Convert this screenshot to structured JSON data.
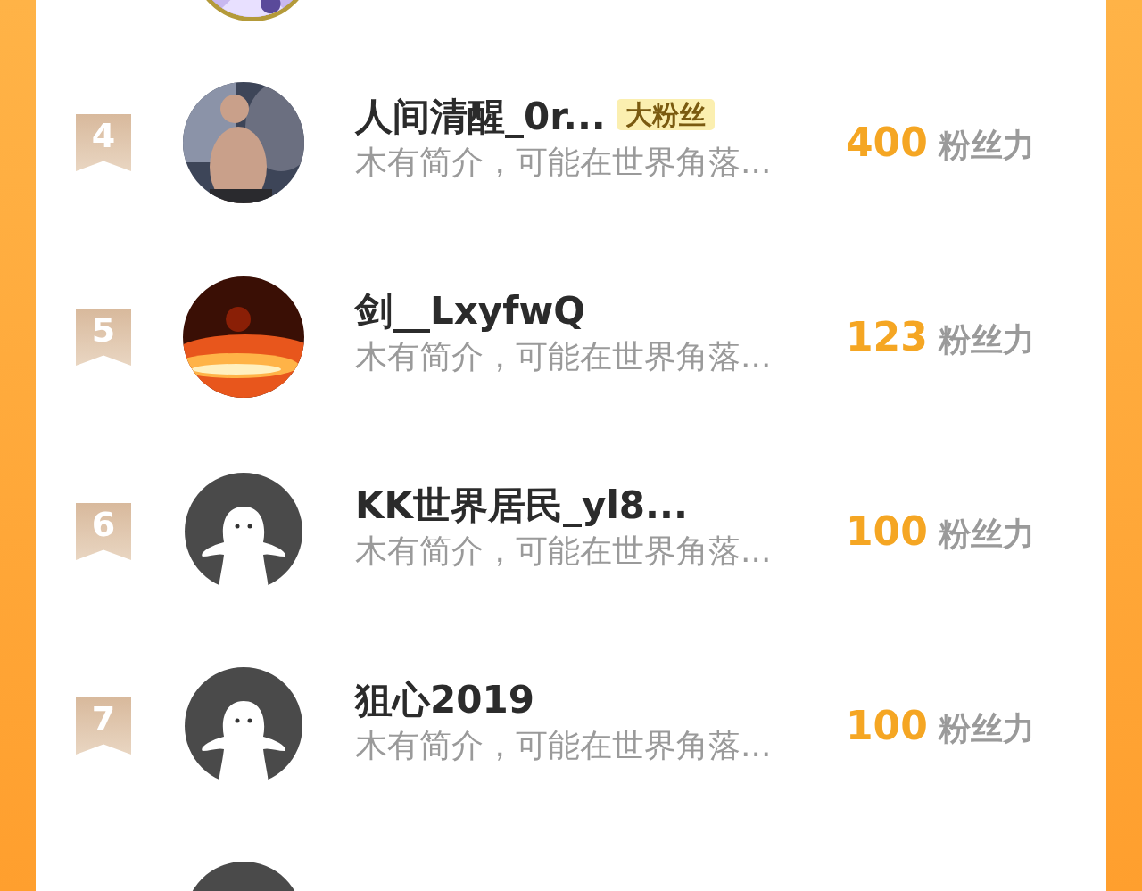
{
  "rows": [
    {
      "rank": "4",
      "name": "人间清醒_0r...",
      "tag": "大粉丝",
      "bio": "木有简介，可能在世界角落...",
      "score": "400",
      "score_unit": "粉丝力"
    },
    {
      "rank": "5",
      "name": "剑__LxyfwQ",
      "bio": "木有简介，可能在世界角落...",
      "score": "123",
      "score_unit": "粉丝力"
    },
    {
      "rank": "6",
      "name": "KK世界居民_yl8...",
      "bio": "木有简介，可能在世界角落...",
      "score": "100",
      "score_unit": "粉丝力",
      "kind": "default"
    },
    {
      "rank": "7",
      "name": "狙心2019",
      "bio": "木有简介，可能在世界角落...",
      "score": "100",
      "score_unit": "粉丝力",
      "kind": "default"
    },
    {
      "kind": "default"
    }
  ]
}
